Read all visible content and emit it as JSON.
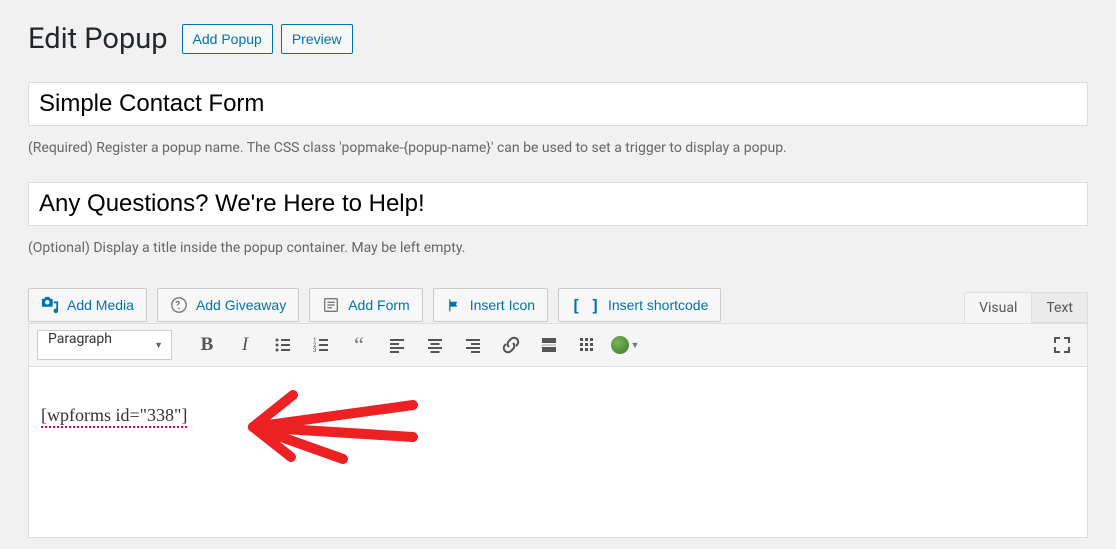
{
  "header": {
    "title": "Edit Popup",
    "add_button": "Add Popup",
    "preview_button": "Preview"
  },
  "name_input": {
    "value": "Simple Contact Form"
  },
  "name_helper": "(Required) Register a popup name. The CSS class 'popmake-{popup-name}' can be used to set a trigger to display a popup.",
  "title_input": {
    "value": "Any Questions? We're Here to Help!"
  },
  "title_helper": "(Optional) Display a title inside the popup container. May be left empty.",
  "media_buttons": {
    "add_media": "Add Media",
    "add_giveaway": "Add Giveaway",
    "add_form": "Add Form",
    "insert_icon": "Insert Icon",
    "insert_shortcode": "Insert shortcode"
  },
  "tabs": {
    "visual": "Visual",
    "text": "Text"
  },
  "format_dropdown": "Paragraph",
  "editor_content": "[wpforms id=\"338\"]",
  "icons": {
    "media": "media-icon",
    "giveaway": "giveaway-icon",
    "form": "form-icon",
    "flag": "flag-icon",
    "brackets": "brackets-icon"
  },
  "colors": {
    "link": "#0073aa",
    "background": "#f1f1f1",
    "annotation": "#ed2024"
  }
}
